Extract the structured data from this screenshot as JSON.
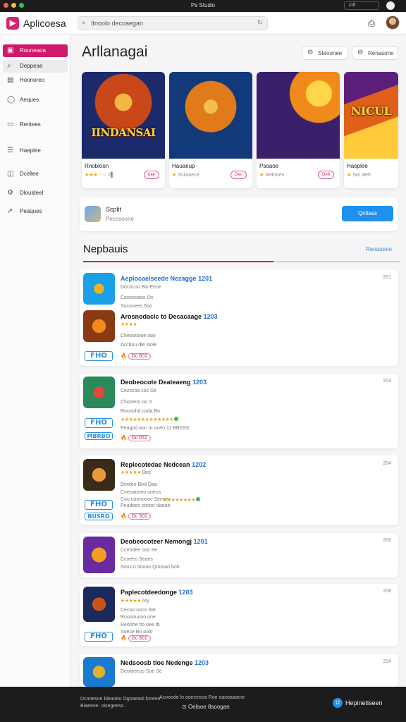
{
  "window": {
    "title": "Ps Studio",
    "pill": "ctrl",
    "colors": [
      "#ff5f57",
      "#febc2e",
      "#28c840"
    ]
  },
  "topbar": {
    "brand": "Aplicoesa",
    "search_placeholder": "Itnoolo decoaegan"
  },
  "sidebar": {
    "items": [
      {
        "label": "Rouneaoa",
        "icon": "store-icon"
      },
      {
        "label": "Deppeae",
        "icon": "search-icon"
      },
      {
        "label": "Hoonoreo",
        "icon": "library-icon"
      },
      {
        "label": "Aeques",
        "icon": "games-icon"
      },
      {
        "label": "Rentees",
        "icon": "calendar-icon"
      },
      {
        "label": "Haeplee",
        "icon": "list-icon"
      },
      {
        "label": "Dcellee",
        "icon": "bag-icon"
      },
      {
        "label": "Dlouldeel",
        "icon": "settings-icon"
      },
      {
        "label": "Peaques",
        "icon": "share-icon"
      }
    ]
  },
  "main": {
    "title": "Arllanagai",
    "header_buttons": [
      {
        "label": "Steoonee",
        "icon": "filter-icon"
      },
      {
        "label": "Renasone",
        "icon": "sort-icon"
      }
    ],
    "featured": [
      {
        "name": "Rnobloon",
        "rating": "★★★☆☆",
        "extra": "2▌",
        "badge": "bae",
        "art_label": "IINDANSAI",
        "colors": [
          "#1a2a6b",
          "#c9481a",
          "#f4b842"
        ]
      },
      {
        "name": "Hauaeup",
        "rating": "★",
        "extra": "3s1ooece",
        "badge": "Deo",
        "art_label": "",
        "colors": [
          "#123a7a",
          "#e07a1b",
          "#f0c04a"
        ]
      },
      {
        "name": "Psoaoe",
        "rating": "★",
        "extra": "3e4rloes",
        "badge": "De9",
        "art_label": "",
        "colors": [
          "#3a1f6b",
          "#f08a1a",
          "#ffd54a"
        ]
      },
      {
        "name": "Haeplee",
        "rating": "★",
        "extra": "Sot oleh",
        "badge": "",
        "art_label": "NICUL",
        "colors": [
          "#5b1f7a",
          "#e0601a",
          "#ffcb3a"
        ]
      }
    ],
    "update": {
      "name": "Scplit",
      "subtitle": "Pecosoone",
      "button": "Qntlass"
    },
    "section": {
      "title": "Nepbauis",
      "link": "Reoaoeeo"
    },
    "list": [
      {
        "date": "201",
        "entries": [
          {
            "title": "Aeplocaelseede Nezagge",
            "year": "1201",
            "lines": [
              "Dococoo Bio Eeoe",
              "Ceoseoaos Os",
              "Socouees 5oo"
            ],
            "icon_colors": [
              "#1ba0e8",
              "#f4b020"
            ]
          },
          {
            "title": "Arosnodaclc to Decacaage",
            "year": "1203",
            "stars": "★★★★",
            "lines": [
              "Cheoooooe ooo",
              "Accbou dle loole"
            ],
            "badge": "Dc 001",
            "fbox": "FHO",
            "icon_colors": [
              "#f08a1a",
              "#8a3a12"
            ]
          }
        ]
      },
      {
        "date": "204",
        "entries": [
          {
            "title": "Deobeocote Deateaeng",
            "year": "1203",
            "lines": [
              "Cezscoa cos Gii",
              "Chooeoo oo 3",
              "Rouoohd coda Bo"
            ],
            "stars": "★★★★★★★★★★★★★",
            "fbox": "FHO",
            "fbox2": "MBRBO",
            "badge": "Dc 051",
            "sub": "Peagod aon to ooeo 11 BBSSS",
            "icon_colors": [
              "#2b8a5a",
              "#e04a3a"
            ]
          }
        ]
      },
      {
        "date": "204",
        "entries": [
          {
            "title": "Replecotedae Nedcean",
            "year": "1202",
            "stars": "★★★★★",
            "star_note": "Beej",
            "lines": [
              "Deoteo Bod Daa",
              "Coeoaooeo uoeos",
              "Cou ooonoooc Seeaec"
            ],
            "stars2": "★★★★★★★★",
            "fbox": "FHO",
            "fbox2": "BUSRO",
            "sub": "Peudeeo ctcoor doeoe",
            "badge": "Dc 301",
            "icon_colors": [
              "#3a2a1a",
              "#e89a3a"
            ]
          }
        ]
      },
      {
        "date": "206",
        "entries": [
          {
            "title": "Deobeocoteer Nemongj",
            "year": "1201",
            "lines": [
              "Ccehdee ooo Se",
              "Ccoeeo Seaes",
              "Soos o doooo  Qoooao bob"
            ],
            "icon_colors": [
              "#6a2aa0",
              "#f0a020"
            ]
          }
        ]
      },
      {
        "date": "206",
        "entries": [
          {
            "title": "Paplecotdeedonge",
            "year": "1203",
            "stars": "★★★★★",
            "star_note": "Aoy",
            "lines": [
              "Cecoo ooco Ste",
              "Roooounoo one",
              "Reoohe tto oee tb",
              "Soece Bo oolo"
            ],
            "fbox": "FHO",
            "badge": "Dc 301",
            "icon_colors": [
              "#1a2a5a",
              "#c9541a"
            ]
          }
        ]
      },
      {
        "date": "204",
        "entries": [
          {
            "title": "Nedsoosb tloe Nedenge",
            "year": "1203",
            "lines": [
              "Deoloeeuo Soe Se"
            ],
            "icon_colors": [
              "#1a7ad0",
              "#e0b030"
            ]
          }
        ]
      }
    ]
  },
  "bottom": {
    "left1": "Dcooesoe bleaoeo Ogoaeaol loneeo",
    "left2": "Biaeeoe. oisegeeso",
    "mid1": "Acooode lo ooeceooa Roe oanoaaacor",
    "mid2": "Oelaoe 8soogan",
    "right": "Hepinetiseen"
  }
}
